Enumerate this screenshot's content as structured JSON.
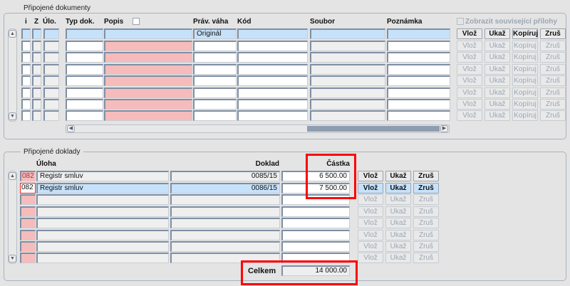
{
  "documents": {
    "title": "Připojené dokumenty",
    "headers": {
      "i": "i",
      "z": "Z",
      "ulo": "Úlo.",
      "typ": "Typ dok.",
      "popis": "Popis",
      "prav": "Práv. váha",
      "kod": "Kód",
      "soubor": "Soubor",
      "poznamka": "Poznámka"
    },
    "show_related_label": "Zobrazit související přílohy",
    "rows": [
      {
        "prav": "Originál",
        "selected": true,
        "enabled": true
      },
      {
        "prav": "",
        "selected": false,
        "enabled": false
      },
      {
        "prav": "",
        "selected": false,
        "enabled": false
      },
      {
        "prav": "",
        "selected": false,
        "enabled": false
      },
      {
        "prav": "",
        "selected": false,
        "enabled": false
      },
      {
        "prav": "",
        "selected": false,
        "enabled": false
      },
      {
        "prav": "",
        "selected": false,
        "enabled": false
      },
      {
        "prav": "",
        "selected": false,
        "enabled": false
      }
    ],
    "buttons": {
      "insert": "Vlož",
      "show": "Ukaž",
      "copy": "Kopíruj",
      "cancel": "Zruš"
    }
  },
  "receipts": {
    "title": "Připojené doklady",
    "headers": {
      "uloha": "Úloha",
      "doklad": "Doklad",
      "castka": "Částka"
    },
    "rows": [
      {
        "code": "082",
        "uloha": "Registr smluv",
        "doklad": "0085/15",
        "castka": "6 500.00",
        "selected": false,
        "enabled": true
      },
      {
        "code": "082",
        "uloha": "Registr smluv",
        "doklad": "0086/15",
        "castka": "7 500.00",
        "selected": true,
        "enabled": true
      },
      {
        "code": "",
        "uloha": "",
        "doklad": "",
        "castka": "",
        "selected": false,
        "enabled": false
      },
      {
        "code": "",
        "uloha": "",
        "doklad": "",
        "castka": "",
        "selected": false,
        "enabled": false
      },
      {
        "code": "",
        "uloha": "",
        "doklad": "",
        "castka": "",
        "selected": false,
        "enabled": false
      },
      {
        "code": "",
        "uloha": "",
        "doklad": "",
        "castka": "",
        "selected": false,
        "enabled": false
      },
      {
        "code": "",
        "uloha": "",
        "doklad": "",
        "castka": "",
        "selected": false,
        "enabled": false
      },
      {
        "code": "",
        "uloha": "",
        "doklad": "",
        "castka": "",
        "selected": false,
        "enabled": false
      }
    ],
    "buttons": {
      "insert": "Vlož",
      "show": "Ukaž",
      "cancel": "Zruš"
    },
    "total_label": "Celkem",
    "total_value": "14 000.00"
  }
}
